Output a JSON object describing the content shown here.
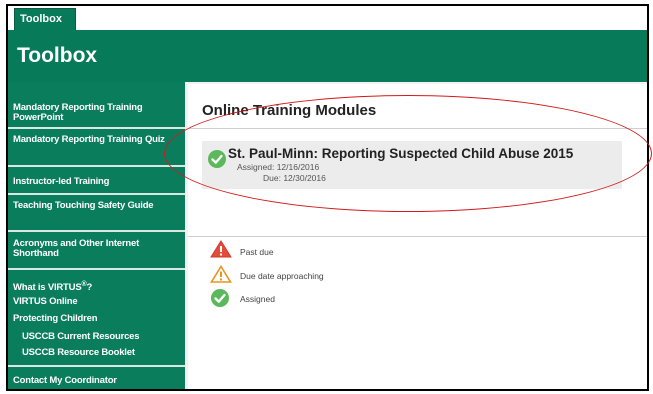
{
  "tab": {
    "label": "Toolbox"
  },
  "header": {
    "title": "Toolbox"
  },
  "sidebar": {
    "items": [
      {
        "label": "Mandatory Reporting Training PowerPoint"
      },
      {
        "label": "Mandatory Reporting Training Quiz"
      },
      {
        "label": "Instructor-led Training"
      },
      {
        "label": "Teaching Touching Safety Guide"
      },
      {
        "label": "Acronyms and Other Internet Shorthand"
      }
    ],
    "virtus": {
      "what_is": "What is VIRTUS",
      "reg": "®",
      "q": "?",
      "online": "VIRTUS Online",
      "protecting": "Protecting Children"
    },
    "sub_items": [
      {
        "label": "USCCB Current Resources"
      },
      {
        "label": "USCCB Resource Booklet"
      }
    ],
    "contact": "Contact My Coordinator"
  },
  "main": {
    "title": "Online Training Modules",
    "module": {
      "title": "St. Paul-Minn: Reporting Suspected Child Abuse 2015",
      "assigned": "Assigned: 12/16/2016",
      "due": "Due: 12/30/2016"
    },
    "legend": [
      {
        "label": "Past due",
        "icon": "warning-red-icon"
      },
      {
        "label": "Due date approaching",
        "icon": "warning-outline-icon"
      },
      {
        "label": "Assigned",
        "icon": "check-icon"
      }
    ]
  },
  "colors": {
    "brand_green": "#077a5a",
    "highlight_ellipse": "#d21a1a",
    "check_green": "#5cb85c",
    "warning_red": "#e34b3a"
  }
}
